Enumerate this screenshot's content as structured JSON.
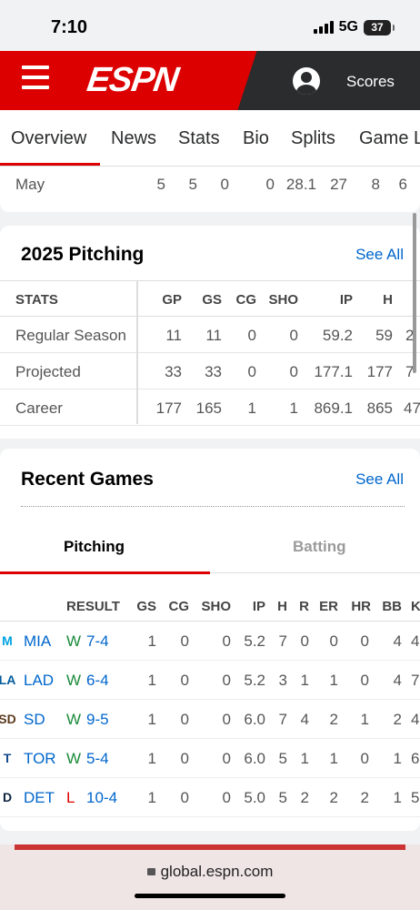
{
  "status_bar": {
    "time": "7:10",
    "network": "5G",
    "battery": "37"
  },
  "header": {
    "logo": "ESPN",
    "scores_label": "Scores"
  },
  "tabs": [
    "Overview",
    "News",
    "Stats",
    "Bio",
    "Splits",
    "Game L"
  ],
  "month_row": {
    "label": "May",
    "values": [
      "5",
      "5",
      "0",
      "0",
      "28.1",
      "27",
      "8",
      "6"
    ]
  },
  "pitching": {
    "title": "2025 Pitching",
    "see_all": "See All",
    "columns": [
      "STATS",
      "GP",
      "GS",
      "CG",
      "SHO",
      "IP",
      "H"
    ],
    "rows": [
      {
        "label": "Regular Season",
        "values": [
          "11",
          "11",
          "0",
          "0",
          "59.2",
          "59",
          "2"
        ]
      },
      {
        "label": "Projected",
        "values": [
          "33",
          "33",
          "0",
          "0",
          "177.1",
          "177",
          "7"
        ]
      },
      {
        "label": "Career",
        "values": [
          "177",
          "165",
          "1",
          "1",
          "869.1",
          "865",
          "47"
        ]
      }
    ]
  },
  "recent_games": {
    "title": "Recent Games",
    "see_all": "See All",
    "subtabs": [
      "Pitching",
      "Batting"
    ],
    "columns": [
      "RESULT",
      "GS",
      "CG",
      "SHO",
      "IP",
      "H",
      "R",
      "ER",
      "HR",
      "BB",
      "K"
    ],
    "rows": [
      {
        "opp": "MIA",
        "logo": "M",
        "wl": "W",
        "score": "7-4",
        "values": [
          "1",
          "0",
          "0",
          "5.2",
          "7",
          "0",
          "0",
          "0",
          "4",
          "4"
        ]
      },
      {
        "opp": "LAD",
        "logo": "LA",
        "wl": "W",
        "score": "6-4",
        "values": [
          "1",
          "0",
          "0",
          "5.2",
          "3",
          "1",
          "1",
          "0",
          "4",
          "7"
        ]
      },
      {
        "opp": "SD",
        "logo": "SD",
        "wl": "W",
        "score": "9-5",
        "values": [
          "1",
          "0",
          "0",
          "6.0",
          "7",
          "4",
          "2",
          "1",
          "2",
          "4"
        ]
      },
      {
        "opp": "TOR",
        "logo": "T",
        "wl": "W",
        "score": "5-4",
        "values": [
          "1",
          "0",
          "0",
          "6.0",
          "5",
          "1",
          "1",
          "0",
          "1",
          "6"
        ]
      },
      {
        "opp": "DET",
        "logo": "D",
        "wl": "L",
        "score": "10-4",
        "values": [
          "1",
          "0",
          "0",
          "5.0",
          "5",
          "2",
          "2",
          "2",
          "1",
          "5"
        ]
      }
    ]
  },
  "colors": {
    "accent": "#dd0000",
    "win": "#1a8a3a",
    "loss": "#dd0000",
    "link": "#0066cc"
  },
  "url_bar": {
    "url": "global.espn.com"
  }
}
